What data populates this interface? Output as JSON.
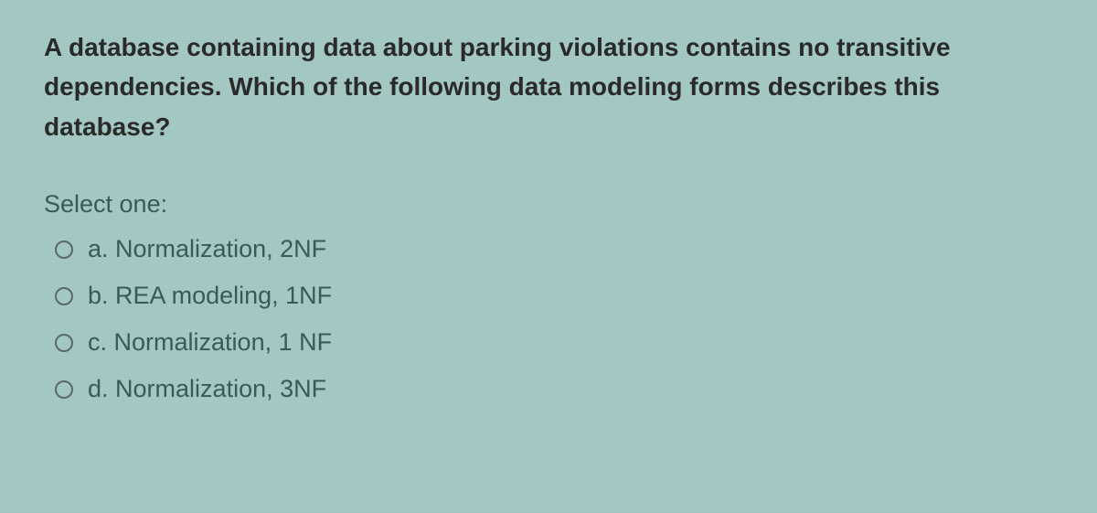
{
  "question": "A database containing data about parking violations contains no transitive dependencies. Which of the following data modeling forms describes this database?",
  "select_label": "Select one:",
  "options": [
    {
      "letter": "a.",
      "text": "Normalization, 2NF"
    },
    {
      "letter": "b.",
      "text": "REA modeling, 1NF"
    },
    {
      "letter": "c.",
      "text": "Normalization, 1 NF"
    },
    {
      "letter": "d.",
      "text": "Normalization, 3NF"
    }
  ]
}
